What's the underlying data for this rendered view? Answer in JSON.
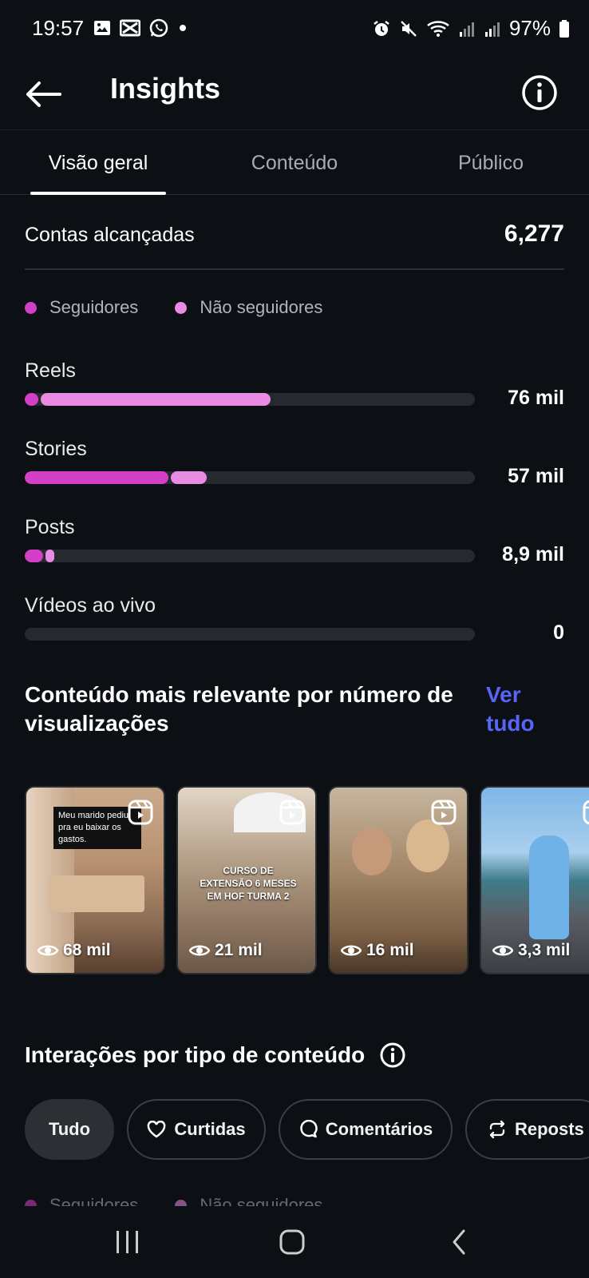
{
  "status": {
    "time": "19:57",
    "battery": "97%",
    "left_icons": [
      "gallery-icon",
      "capcut-icon",
      "whatsapp-icon",
      "dot-icon"
    ],
    "right_icons": [
      "alarm-icon",
      "mute-icon",
      "wifi-icon",
      "signal-icon",
      "signal-icon",
      "battery-icon"
    ]
  },
  "header": {
    "title": "Insights"
  },
  "tabs": [
    {
      "label": "Visão geral",
      "active": true
    },
    {
      "label": "Conteúdo",
      "active": false
    },
    {
      "label": "Público",
      "active": false
    }
  ],
  "reach": {
    "label": "Contas alcançadas",
    "value": "6,277"
  },
  "legend": {
    "followers": {
      "label": "Seguidores",
      "color": "#d43fc7"
    },
    "non_followers": {
      "label": "Não seguidores",
      "color": "#e98be2"
    }
  },
  "breakdown": [
    {
      "label": "Reels",
      "value": "76 mil",
      "followers_fraction": 0.03,
      "non_followers_fraction": 0.51
    },
    {
      "label": "Stories",
      "value": "57 mil",
      "followers_fraction": 0.32,
      "non_followers_fraction": 0.08
    },
    {
      "label": "Posts",
      "value": "8,9 mil",
      "followers_fraction": 0.04,
      "non_followers_fraction": 0.02
    },
    {
      "label": "Vídeos ao vivo",
      "value": "0",
      "followers_fraction": 0,
      "non_followers_fraction": 0
    }
  ],
  "top_content": {
    "title": "Conteúdo mais relevante por número de visualizações",
    "see_all": "Ver tudo",
    "items": [
      {
        "views": "68 mil",
        "caption": "Meu marido pediu pra eu baixar os gastos."
      },
      {
        "views": "21 mil",
        "caption": "CURSO DE EXTENSÃO 6 MESES EM HOF TURMA 2"
      },
      {
        "views": "16 mil",
        "caption": ""
      },
      {
        "views": "3,3 mil",
        "caption": ""
      }
    ]
  },
  "interactions": {
    "title": "Interações por tipo de conteúdo",
    "chips": [
      {
        "label": "Tudo",
        "icon": "",
        "active": true
      },
      {
        "label": "Curtidas",
        "icon": "heart-icon",
        "active": false
      },
      {
        "label": "Comentários",
        "icon": "comment-icon",
        "active": false
      },
      {
        "label": "Reposts",
        "icon": "repost-icon",
        "active": false
      }
    ],
    "legend": {
      "followers": "Seguidores",
      "non_followers": "Não seguidores"
    }
  }
}
